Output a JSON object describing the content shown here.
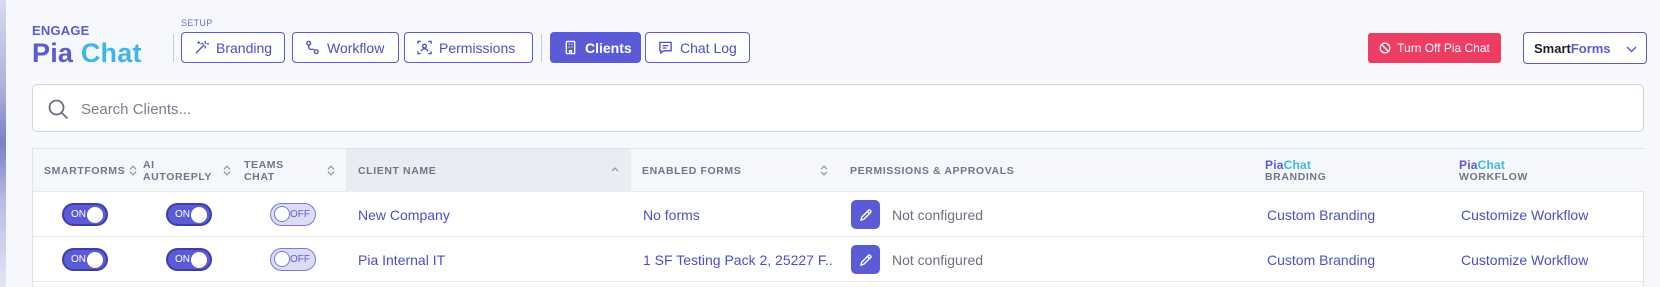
{
  "brand": {
    "kicker": "ENGAGE",
    "title_part1": "Pia",
    "title_part2": "Chat"
  },
  "setup": {
    "label": "SETUP"
  },
  "nav": {
    "branding": "Branding",
    "workflow": "Workflow",
    "permissions": "Permissions",
    "clients": "Clients",
    "chatlog": "Chat Log"
  },
  "actions": {
    "turn_off": "Turn Off Pia Chat"
  },
  "product_select": {
    "part1": "Smart",
    "part2": "Forms"
  },
  "search": {
    "placeholder": "Search Clients...",
    "value": ""
  },
  "table": {
    "headers": {
      "smartforms": "SMARTFORMS",
      "ai_autoreply": "AI AUTOREPLY",
      "teams_chat": "TEAMS CHAT",
      "client_name": "CLIENT NAME",
      "enabled_forms": "ENABLED FORMS",
      "permissions": "PERMISSIONS & APPROVALS",
      "branding_pia": "Pia",
      "branding_chat": "Chat",
      "branding_sub": "BRANDING",
      "workflow_pia": "Pia",
      "workflow_chat": "Chat",
      "workflow_sub": "WORKFLOW"
    },
    "rows": [
      {
        "smartforms": "ON",
        "ai_autoreply": "ON",
        "teams_chat": "OFF",
        "client_name": "New Company",
        "enabled_forms": "No forms",
        "permissions": "Not configured",
        "branding": "Custom Branding",
        "workflow": "Customize Workflow"
      },
      {
        "smartforms": "ON",
        "ai_autoreply": "ON",
        "teams_chat": "OFF",
        "client_name": "Pia Internal IT",
        "enabled_forms": "1 SF Testing Pack 2, 25227 F...",
        "permissions": "Not configured",
        "branding": "Custom Branding",
        "workflow": "Customize Workflow"
      }
    ]
  },
  "colors": {
    "accent": "#5b5bd6",
    "accent_light": "#3fb6ea",
    "danger": "#ee3d63",
    "background": "#f6f8fc"
  }
}
